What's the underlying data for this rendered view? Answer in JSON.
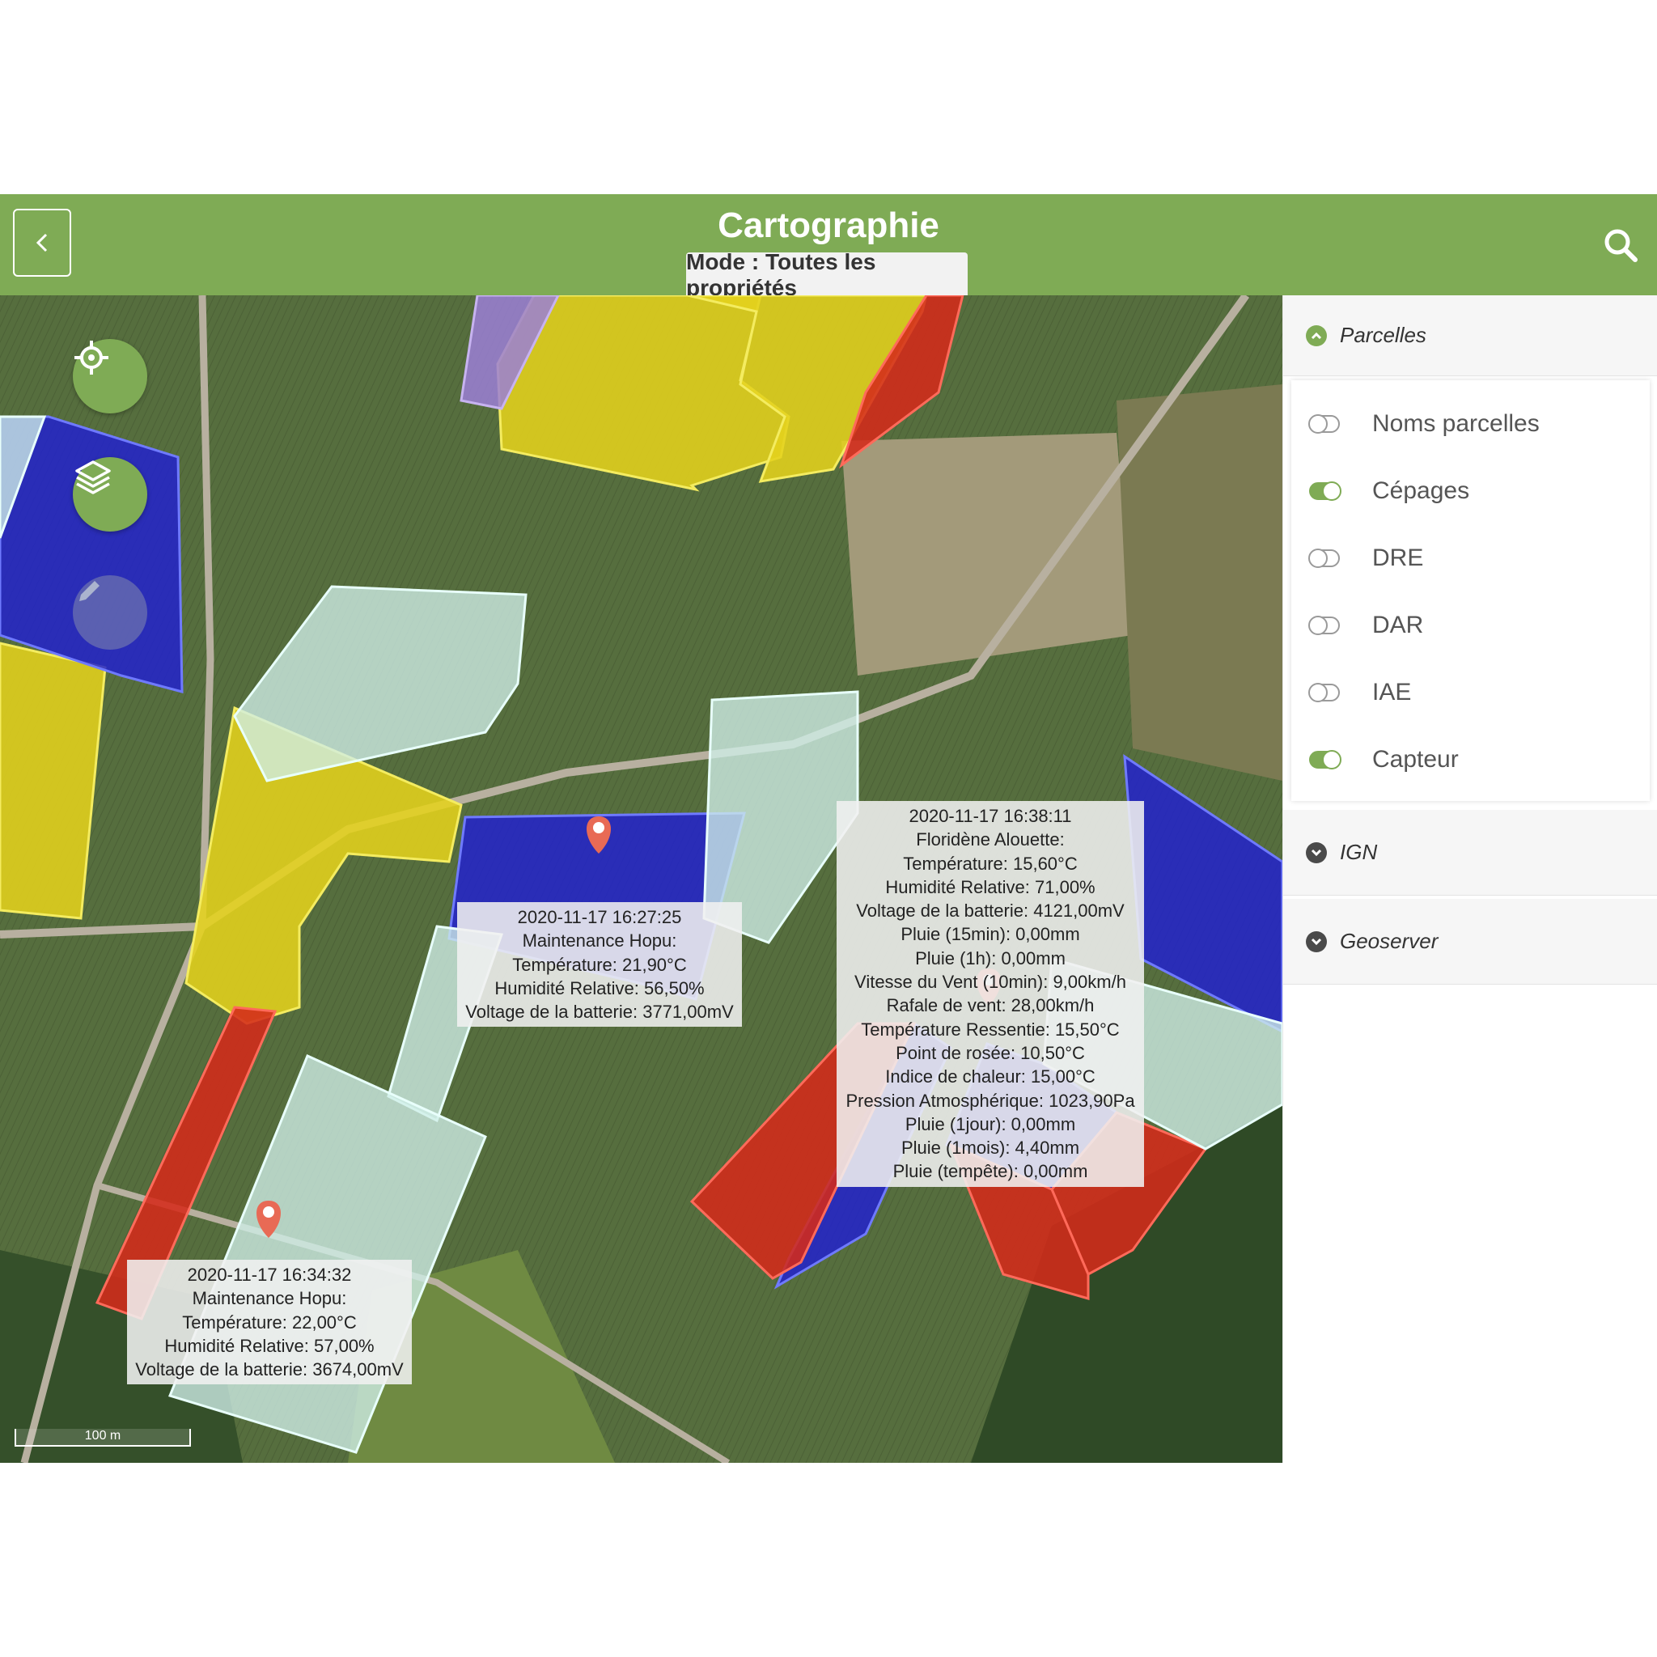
{
  "header": {
    "title": "Cartographie",
    "mode_label": "Mode : Toutes les propriétés"
  },
  "icons": {
    "back": "chevron-left-icon",
    "search": "search-icon",
    "locate": "crosshair-icon",
    "layers": "layers-icon",
    "edit": "pencil-icon"
  },
  "colors": {
    "brand": "#7fab55",
    "parcel_yellow": "#e4d21c",
    "parcel_blue": "#2222cc",
    "parcel_red": "#d42a1a",
    "parcel_purple": "#9b7fd6",
    "parcel_pale": "#cfeee8"
  },
  "popups": [
    {
      "lines": [
        "2020-11-17 16:27:25",
        "Maintenance Hopu:",
        "Température: 21,90°C",
        "Humidité Relative: 56,50%",
        "Voltage de la batterie: 3771,00mV"
      ]
    },
    {
      "lines": [
        "2020-11-17 16:38:11",
        "Floridène Alouette:",
        "Température: 15,60°C",
        "Humidité Relative: 71,00%",
        "Voltage de la batterie: 4121,00mV",
        "Pluie (15min): 0,00mm",
        "Pluie (1h): 0,00mm",
        "Vitesse du Vent (10min): 9,00km/h",
        "Rafale de vent: 28,00km/h",
        "Température Ressentie: 15,50°C",
        "Point de rosée: 10,50°C",
        "Indice de chaleur: 15,00°C",
        "Pression Atmosphérique: 1023,90Pa",
        "Pluie (1jour): 0,00mm",
        "Pluie (1mois): 4,40mm",
        "Pluie (tempête): 0,00mm"
      ]
    },
    {
      "lines": [
        "2020-11-17 16:34:32",
        "Maintenance Hopu:",
        "Température: 22,00°C",
        "Humidité Relative: 57,00%",
        "Voltage de la batterie: 3674,00mV"
      ]
    }
  ],
  "scale_label": "100 m",
  "sidebar": {
    "sections": [
      {
        "title": "Parcelles",
        "expanded": true,
        "items": [
          {
            "label": "Noms parcelles",
            "on": false
          },
          {
            "label": "Cépages",
            "on": true
          },
          {
            "label": "DRE",
            "on": false
          },
          {
            "label": "DAR",
            "on": false
          },
          {
            "label": "IAE",
            "on": false
          },
          {
            "label": "Capteur",
            "on": true
          }
        ]
      },
      {
        "title": "IGN",
        "expanded": false
      },
      {
        "title": "Geoserver",
        "expanded": false
      }
    ]
  }
}
